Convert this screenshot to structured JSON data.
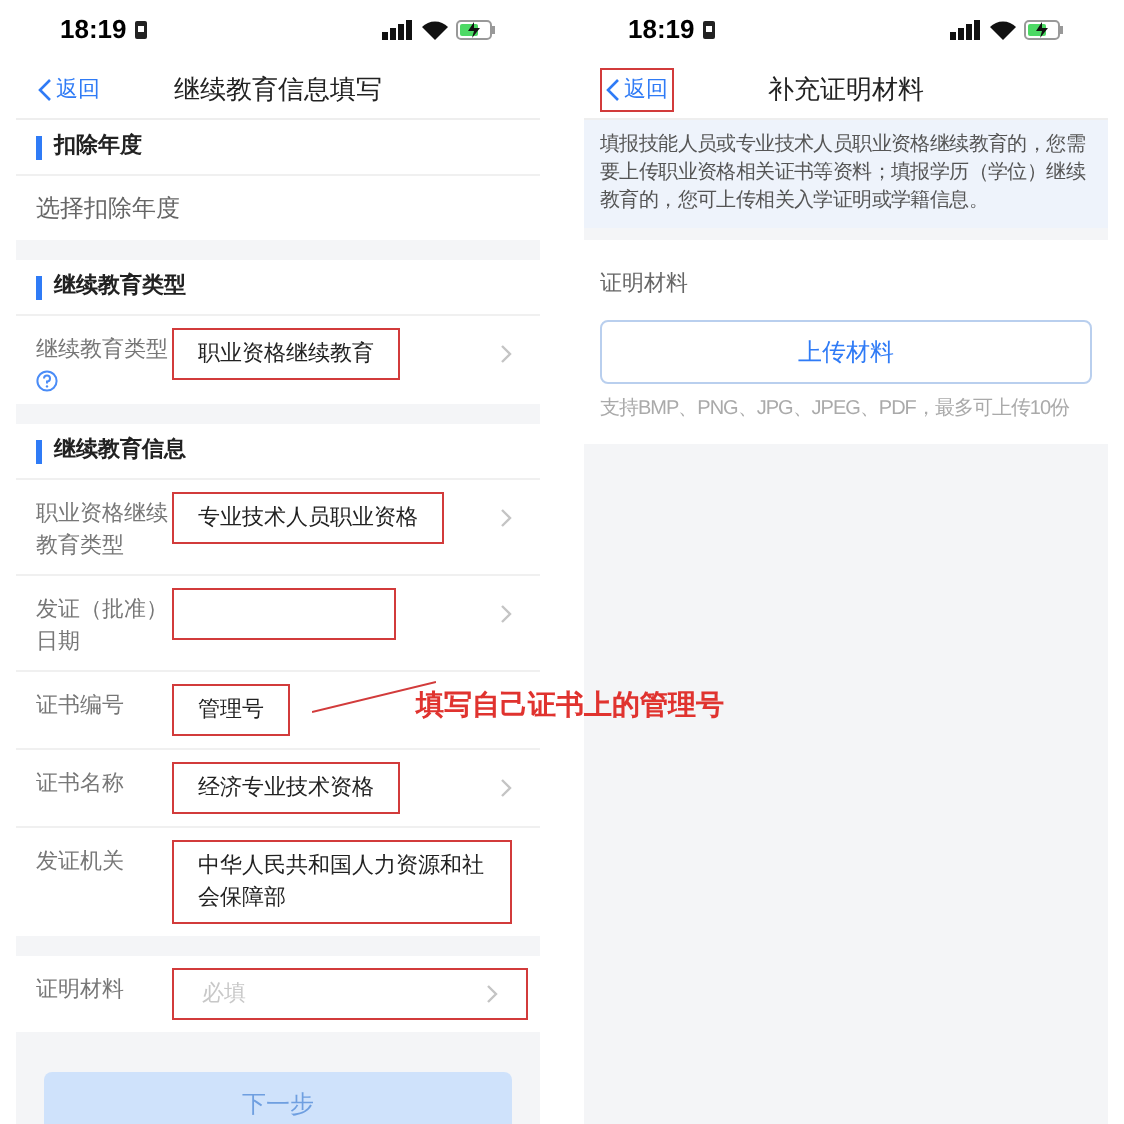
{
  "screens": [
    {
      "kind": "form",
      "status_bar": {
        "time": "18:19"
      },
      "nav": {
        "back": "返回",
        "back_highlighted": false,
        "title": "继续教育信息填写"
      },
      "sections": [
        {
          "title": "扣除年度",
          "rows": [
            {
              "kind": "prompt",
              "text": "选择扣除年度"
            }
          ]
        },
        {
          "title": "继续教育类型",
          "rows": [
            {
              "kind": "field",
              "label": "继续教育类型",
              "help": true,
              "value": "职业资格继续教育",
              "chevron": true,
              "highlighted": true
            }
          ]
        },
        {
          "title": "继续教育信息",
          "rows": [
            {
              "kind": "field",
              "label": "职业资格继续教育类型",
              "value": "专业技术人员职业资格",
              "chevron": true,
              "highlighted": true
            },
            {
              "kind": "field",
              "label": "发证（批准）日期",
              "chevron": true,
              "highlighted": true
            },
            {
              "kind": "field",
              "label": "证书编号",
              "value": "管理号",
              "chevron": false,
              "highlighted": true,
              "annotation": "填写自己证书上的管理号"
            },
            {
              "kind": "field",
              "label": "证书名称",
              "value": "经济专业技术资格",
              "chevron": true,
              "highlighted": true
            },
            {
              "kind": "field",
              "label": "发证机关",
              "value": "中华人民共和国人力资源和社会保障部",
              "chevron": false,
              "highlighted": true
            }
          ]
        },
        {
          "rows": [
            {
              "kind": "field",
              "label": "证明材料",
              "placeholder": "必填",
              "chevron": true,
              "highlighted": true
            }
          ]
        }
      ],
      "button": {
        "label": "下一步",
        "disabled": true
      }
    },
    {
      "kind": "upload",
      "status_bar": {
        "time": "18:19"
      },
      "nav": {
        "back": "返回",
        "back_highlighted": true,
        "title": "补充证明材料"
      },
      "notice": "填报技能人员或专业技术人员职业资格继续教育的，您需要上传职业资格相关证书等资料；填报学历（学位）继续教育的，您可上传相关入学证明或学籍信息。",
      "label": "证明材料",
      "upload_button": "上传材料",
      "hint": "支持BMP、PNG、JPG、JPEG、PDF，最多可上传10份"
    }
  ]
}
